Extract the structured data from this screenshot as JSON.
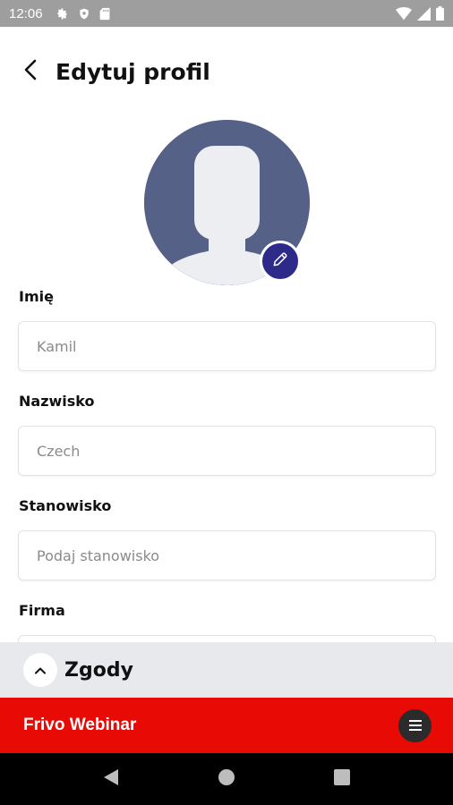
{
  "status_bar": {
    "time": "12:06",
    "left_icons": [
      "gear-icon",
      "shield-icon",
      "sd-card-icon"
    ],
    "right_icons": [
      "wifi-icon",
      "signal-icon",
      "battery-icon"
    ]
  },
  "header": {
    "back_icon": "arrow-left-icon",
    "title": "Edytuj profil"
  },
  "avatar": {
    "background_color": "#556187",
    "edit_icon": "pencil-icon",
    "edit_button_color": "#2e2a8a"
  },
  "form": {
    "first_name": {
      "label": "Imię",
      "value": "",
      "placeholder": "Kamil"
    },
    "last_name": {
      "label": "Nazwisko",
      "value": "",
      "placeholder": "Czech"
    },
    "position": {
      "label": "Stanowisko",
      "value": "",
      "placeholder": "Podaj stanowisko"
    },
    "company": {
      "label": "Firma",
      "value": "",
      "placeholder": ""
    }
  },
  "consents": {
    "label": "Zgody",
    "toggle_icon": "chevron-up-icon"
  },
  "brand_bar": {
    "name": "Frivo Webinar",
    "menu_icon": "hamburger-menu-icon",
    "color": "#e70a05"
  },
  "nav_bar": {
    "buttons": [
      "back-triangle-icon",
      "home-circle-icon",
      "recents-square-icon"
    ]
  }
}
